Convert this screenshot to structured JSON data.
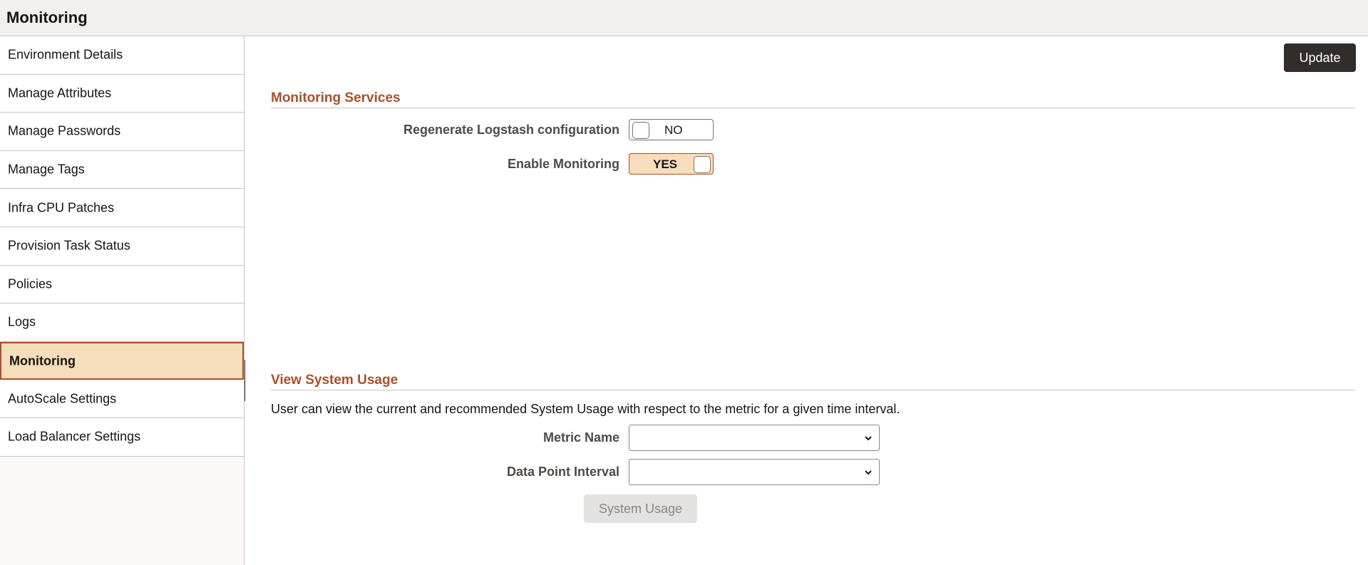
{
  "header": {
    "title": "Monitoring"
  },
  "sidebar": {
    "items": [
      {
        "label": "Environment Details"
      },
      {
        "label": "Manage Attributes"
      },
      {
        "label": "Manage Passwords"
      },
      {
        "label": "Manage Tags"
      },
      {
        "label": "Infra CPU Patches"
      },
      {
        "label": "Provision Task Status"
      },
      {
        "label": "Policies"
      },
      {
        "label": "Logs"
      },
      {
        "label": "Monitoring",
        "active": true
      },
      {
        "label": "AutoScale Settings"
      },
      {
        "label": "Load Balancer Settings"
      }
    ]
  },
  "toolbar": {
    "update_label": "Update"
  },
  "monitoring_services": {
    "title": "Monitoring Services",
    "regenerate": {
      "label": "Regenerate Logstash configuration",
      "value": "NO"
    },
    "enable": {
      "label": "Enable Monitoring",
      "value": "YES"
    }
  },
  "system_usage": {
    "title": "View System Usage",
    "description": "User can view the current and recommended System Usage with respect to the metric for a given time interval.",
    "metric_name": {
      "label": "Metric Name",
      "value": ""
    },
    "data_point_interval": {
      "label": "Data Point Interval",
      "value": ""
    },
    "button_label": "System Usage"
  },
  "colors": {
    "accent": "#a8512b",
    "active_bg": "#f6ddbc",
    "dark_button": "#312d2a"
  }
}
